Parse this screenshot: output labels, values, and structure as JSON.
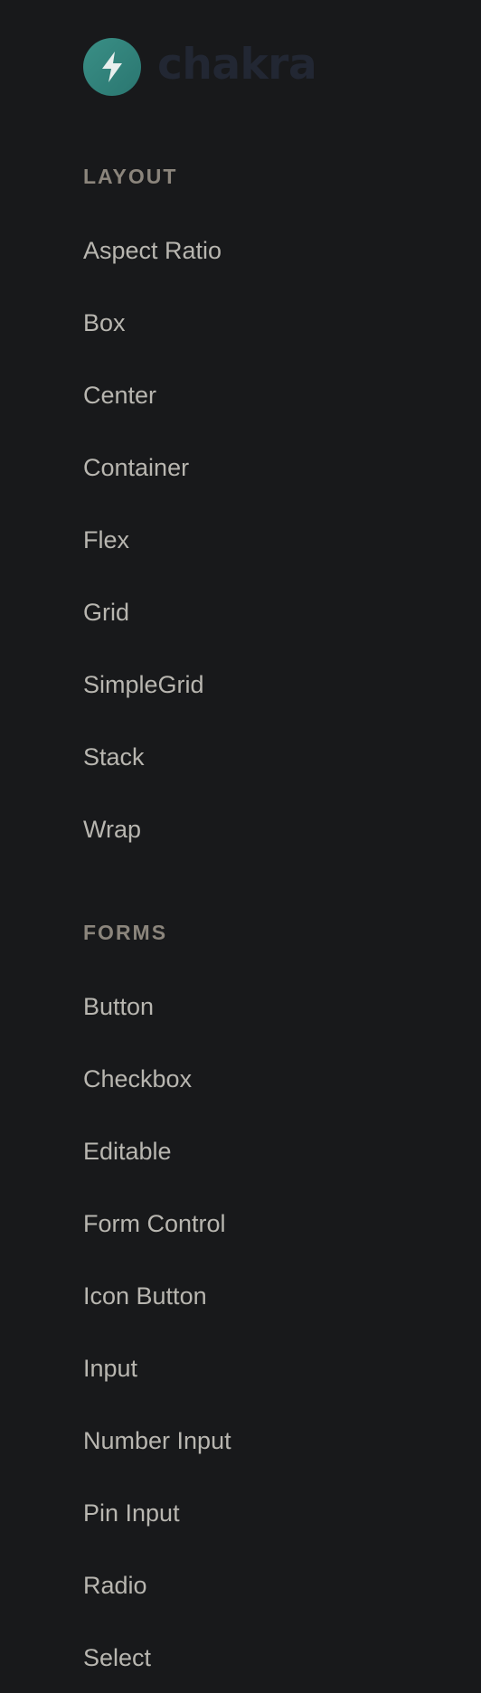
{
  "brand": {
    "name": "chakra",
    "logo_icon": "lightning-bolt-icon",
    "logo_color": "#3a8f86"
  },
  "colors": {
    "background": "#18191b",
    "heading": "#8b857c",
    "item": "#b8b6b0"
  },
  "sections": [
    {
      "heading": "LAYOUT",
      "items": [
        "Aspect Ratio",
        "Box",
        "Center",
        "Container",
        "Flex",
        "Grid",
        "SimpleGrid",
        "Stack",
        "Wrap"
      ]
    },
    {
      "heading": "FORMS",
      "items": [
        "Button",
        "Checkbox",
        "Editable",
        "Form Control",
        "Icon Button",
        "Input",
        "Number Input",
        "Pin Input",
        "Radio",
        "Select"
      ]
    }
  ]
}
